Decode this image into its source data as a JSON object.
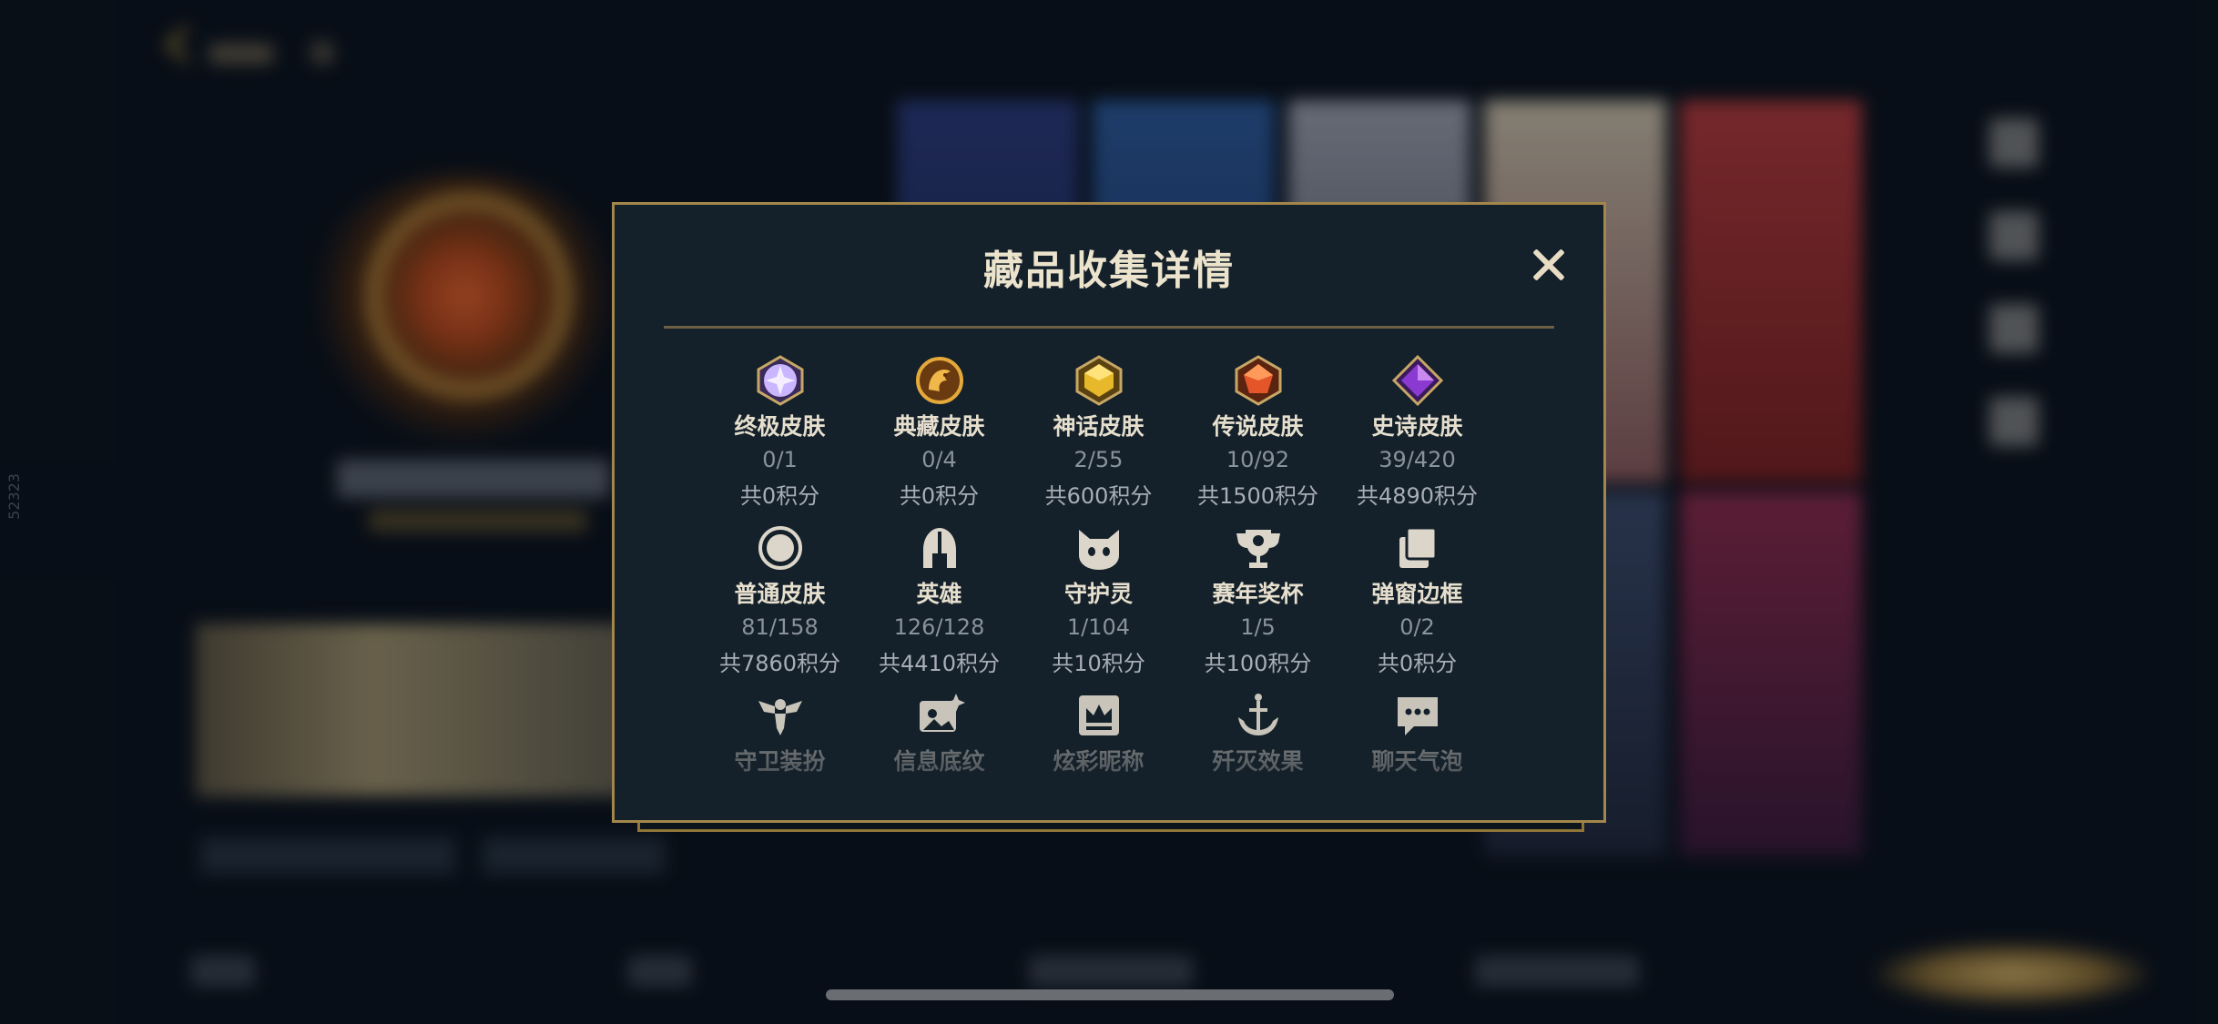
{
  "dialog": {
    "title": "藏品收集详情",
    "close_icon": "close-icon"
  },
  "background": {
    "side_text": "52323"
  },
  "categories": [
    {
      "label": "终极皮肤",
      "count": "0/1",
      "points": "共0积分",
      "icon": "diamond-gem-icon",
      "color": "#c9b6ff"
    },
    {
      "label": "典藏皮肤",
      "count": "0/4",
      "points": "共0积分",
      "icon": "dragon-crest-icon",
      "color": "#d59a2f"
    },
    {
      "label": "神话皮肤",
      "count": "2/55",
      "points": "共600积分",
      "icon": "gold-gem-icon",
      "color": "#e6b82a"
    },
    {
      "label": "传说皮肤",
      "count": "10/92",
      "points": "共1500积分",
      "icon": "orange-gem-icon",
      "color": "#e4552a"
    },
    {
      "label": "史诗皮肤",
      "count": "39/420",
      "points": "共4890积分",
      "icon": "purple-gem-icon",
      "color": "#8a3ad0"
    },
    {
      "label": "普通皮肤",
      "count": "81/158",
      "points": "共7860积分",
      "icon": "ring-icon",
      "color": "#dcd6ca"
    },
    {
      "label": "英雄",
      "count": "126/128",
      "points": "共4410积分",
      "icon": "helmet-icon",
      "color": "#dcd6ca"
    },
    {
      "label": "守护灵",
      "count": "1/104",
      "points": "共10积分",
      "icon": "guardian-spirit-icon",
      "color": "#dcd6ca"
    },
    {
      "label": "赛年奖杯",
      "count": "1/5",
      "points": "共100积分",
      "icon": "trophy-icon",
      "color": "#dcd6ca"
    },
    {
      "label": "弹窗边框",
      "count": "0/2",
      "points": "共0积分",
      "icon": "stacked-frames-icon",
      "color": "#dcd6ca"
    },
    {
      "label": "守卫装扮",
      "icon": "ward-icon",
      "color": "#dcd6ca"
    },
    {
      "label": "信息底纹",
      "icon": "image-sparkle-icon",
      "color": "#dcd6ca"
    },
    {
      "label": "炫彩昵称",
      "icon": "crown-card-icon",
      "color": "#dcd6ca"
    },
    {
      "label": "歼灭效果",
      "icon": "anchor-icon",
      "color": "#dcd6ca"
    },
    {
      "label": "聊天气泡",
      "icon": "chat-bubble-icon",
      "color": "#dcd6ca"
    }
  ]
}
